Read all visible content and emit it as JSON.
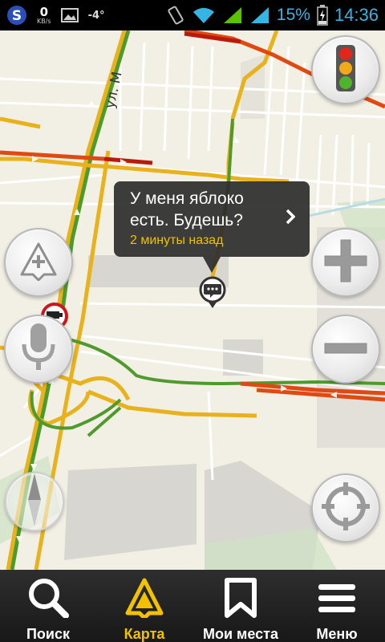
{
  "status_bar": {
    "speed_value": "0",
    "speed_unit": "KB/s",
    "temperature": "-4°",
    "battery_percent": "15%",
    "time": "14:36"
  },
  "map": {
    "street_label": "ул. М",
    "traffic_colors": {
      "green": "#4f9a2c",
      "yellow": "#e8b21c",
      "red": "#e04a12",
      "dark_red": "#b81b0b"
    }
  },
  "comment_bubble": {
    "message": "У меня яблоко есть. Будешь?",
    "time_ago": "2 минуты назад"
  },
  "controls": {
    "traffic_button_icon": "traffic-light-icon",
    "zoom_in_icon": "plus-icon",
    "zoom_out_icon": "minus-icon",
    "locate_icon": "crosshair-icon",
    "compass_icon": "compass-icon"
  },
  "tabs": [
    {
      "label": "Поиск",
      "icon": "search-icon"
    },
    {
      "label": "Карта",
      "icon": "map-arrow-icon"
    },
    {
      "label": "Мои места",
      "icon": "bookmark-icon"
    },
    {
      "label": "Меню",
      "icon": "menu-icon"
    }
  ],
  "accent_color": "#f2c200"
}
